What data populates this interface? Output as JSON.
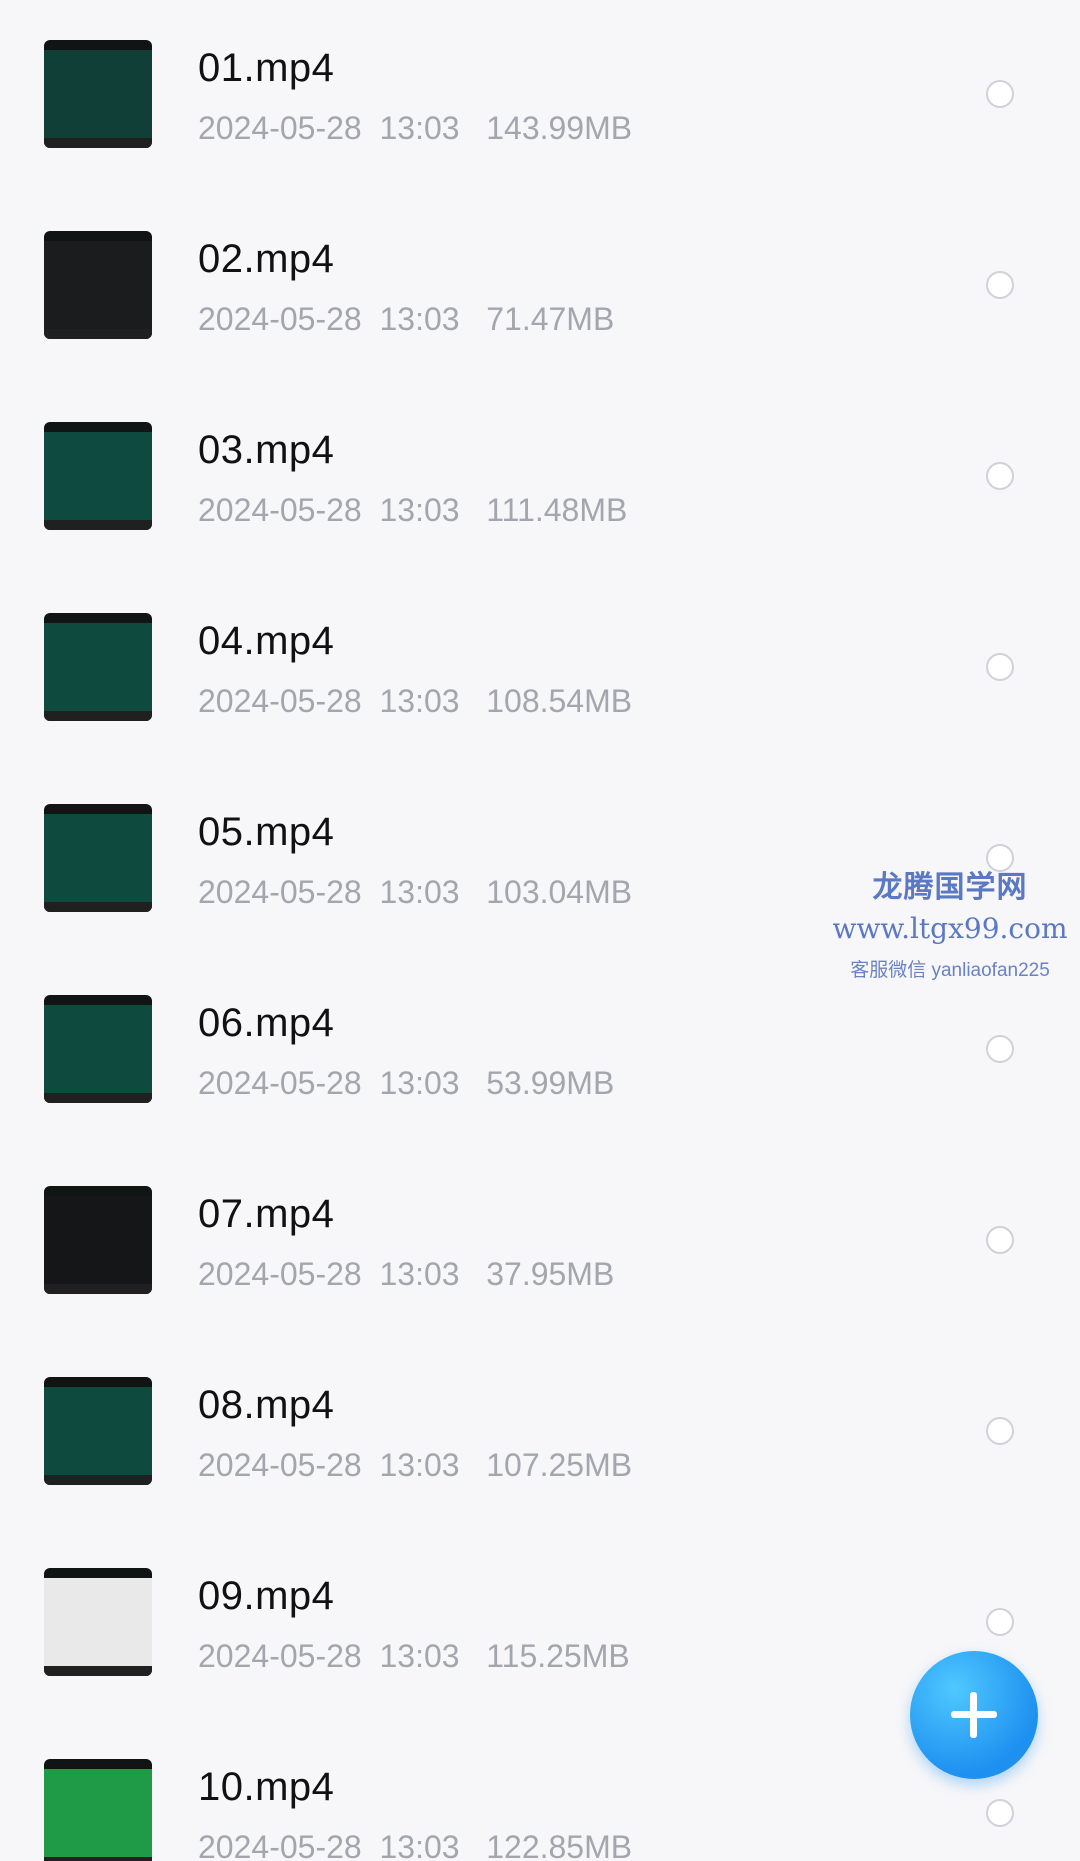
{
  "files": [
    {
      "name": "01.mp4",
      "date": "2024-05-28",
      "time": "13:03",
      "size": "143.99MB",
      "thumb_color": "#0f3f36"
    },
    {
      "name": "02.mp4",
      "date": "2024-05-28",
      "time": "13:03",
      "size": "71.47MB",
      "thumb_color": "#1a1c1e"
    },
    {
      "name": "03.mp4",
      "date": "2024-05-28",
      "time": "13:03",
      "size": "111.48MB",
      "thumb_color": "#0e4a40"
    },
    {
      "name": "04.mp4",
      "date": "2024-05-28",
      "time": "13:03",
      "size": "108.54MB",
      "thumb_color": "#0f4a3f"
    },
    {
      "name": "05.mp4",
      "date": "2024-05-28",
      "time": "13:03",
      "size": "103.04MB",
      "thumb_color": "#0f4a3f"
    },
    {
      "name": "06.mp4",
      "date": "2024-05-28",
      "time": "13:03",
      "size": "53.99MB",
      "thumb_color": "#0f4a3f"
    },
    {
      "name": "07.mp4",
      "date": "2024-05-28",
      "time": "13:03",
      "size": "37.95MB",
      "thumb_color": "#141618"
    },
    {
      "name": "08.mp4",
      "date": "2024-05-28",
      "time": "13:03",
      "size": "107.25MB",
      "thumb_color": "#0f4a3f"
    },
    {
      "name": "09.mp4",
      "date": "2024-05-28",
      "time": "13:03",
      "size": "115.25MB",
      "thumb_color": "#e9e9e9"
    },
    {
      "name": "10.mp4",
      "date": "2024-05-28",
      "time": "13:03",
      "size": "122.85MB",
      "thumb_color": "#1f9b47"
    }
  ],
  "watermark": {
    "title": "龙腾国学网",
    "url": "www.ltgx99.com",
    "contact": "客服微信 yanliaofan225"
  },
  "fab": {
    "icon": "plus-icon",
    "color": "#1e90f0"
  }
}
